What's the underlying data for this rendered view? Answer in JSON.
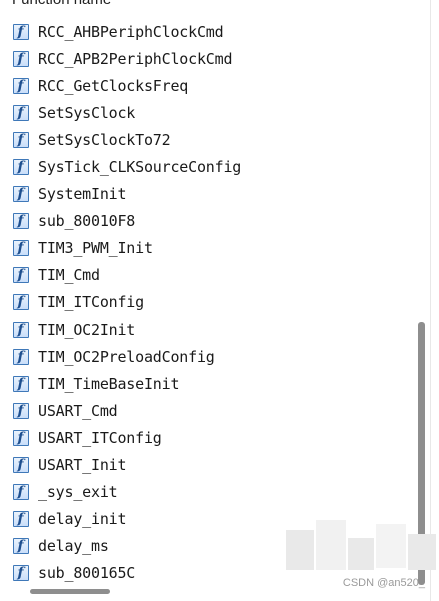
{
  "header": {
    "title": "Function name"
  },
  "icon_glyph": "f",
  "functions": [
    "RCC_AHBPeriphClockCmd",
    "RCC_APB2PeriphClockCmd",
    "RCC_GetClocksFreq",
    "SetSysClock",
    "SetSysClockTo72",
    "SysTick_CLKSourceConfig",
    "SystemInit",
    "sub_80010F8",
    "TIM3_PWM_Init",
    "TIM_Cmd",
    "TIM_ITConfig",
    "TIM_OC2Init",
    "TIM_OC2PreloadConfig",
    "TIM_TimeBaseInit",
    "USART_Cmd",
    "USART_ITConfig",
    "USART_Init",
    "_sys_exit",
    "delay_init",
    "delay_ms",
    "sub_800165C"
  ],
  "watermark": "CSDN @an520_",
  "colors": {
    "icon_border": "#3f78b8",
    "icon_glyph": "#1e4f8f",
    "scrollbar": "#8e8e8e"
  }
}
